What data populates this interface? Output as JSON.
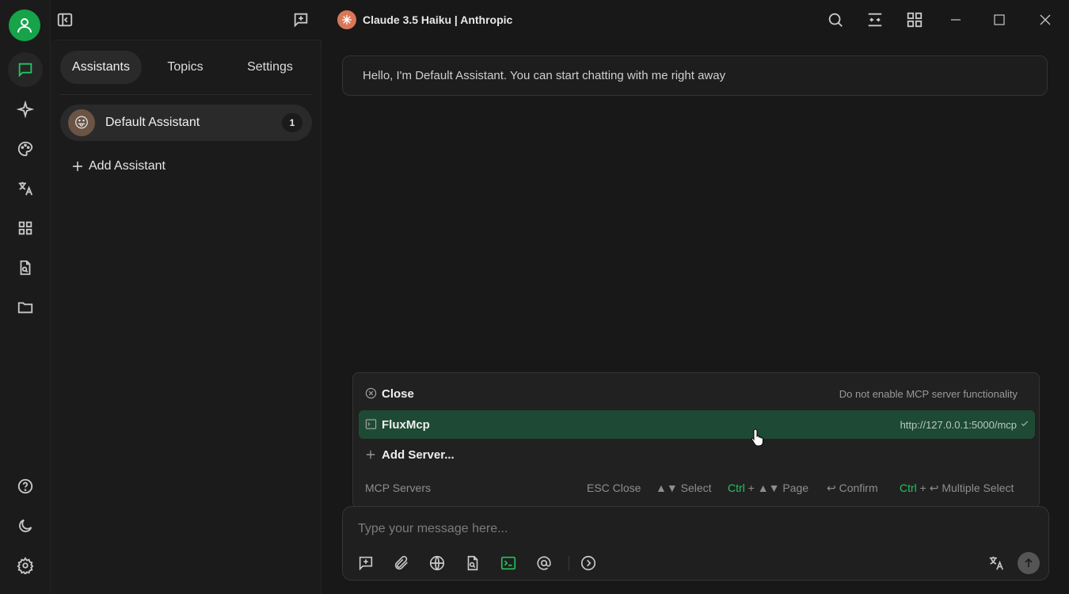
{
  "topbar": {
    "model_name": "Claude 3.5 Haiku | Anthropic"
  },
  "sidebar": {
    "tabs": [
      {
        "label": "Assistants",
        "active": true
      },
      {
        "label": "Topics",
        "active": false
      },
      {
        "label": "Settings",
        "active": false
      }
    ],
    "assistants": [
      {
        "name": "Default Assistant",
        "count": "1",
        "emoji": "😛"
      }
    ],
    "add_assistant_label": "Add Assistant"
  },
  "chat": {
    "welcome_message": "Hello, I'm Default Assistant. You can start chatting with me right away"
  },
  "mcp_popup": {
    "items": [
      {
        "label": "Close",
        "description": "Do not enable MCP server functionality",
        "icon": "close-circle-icon",
        "selected": false
      },
      {
        "label": "FluxMcp",
        "description": "http://127.0.0.1:5000/mcp",
        "icon": "terminal-icon",
        "selected": true,
        "checked": true
      },
      {
        "label": "Add Server...",
        "description": "",
        "icon": "plus-icon",
        "selected": false
      }
    ],
    "footer_title": "MCP Servers",
    "hints": {
      "esc": "ESC Close",
      "select": "▲▼ Select",
      "page_key": "Ctrl",
      "page_rest": "+ ▲▼ Page",
      "confirm": "↩ Confirm",
      "multi_key": "Ctrl",
      "multi_rest": "+ ↩ Multiple Select"
    }
  },
  "input": {
    "placeholder": "Type your message here..."
  },
  "colors": {
    "accent": "#22c55e",
    "selected_row": "#1e4a35",
    "background": "#181818"
  }
}
